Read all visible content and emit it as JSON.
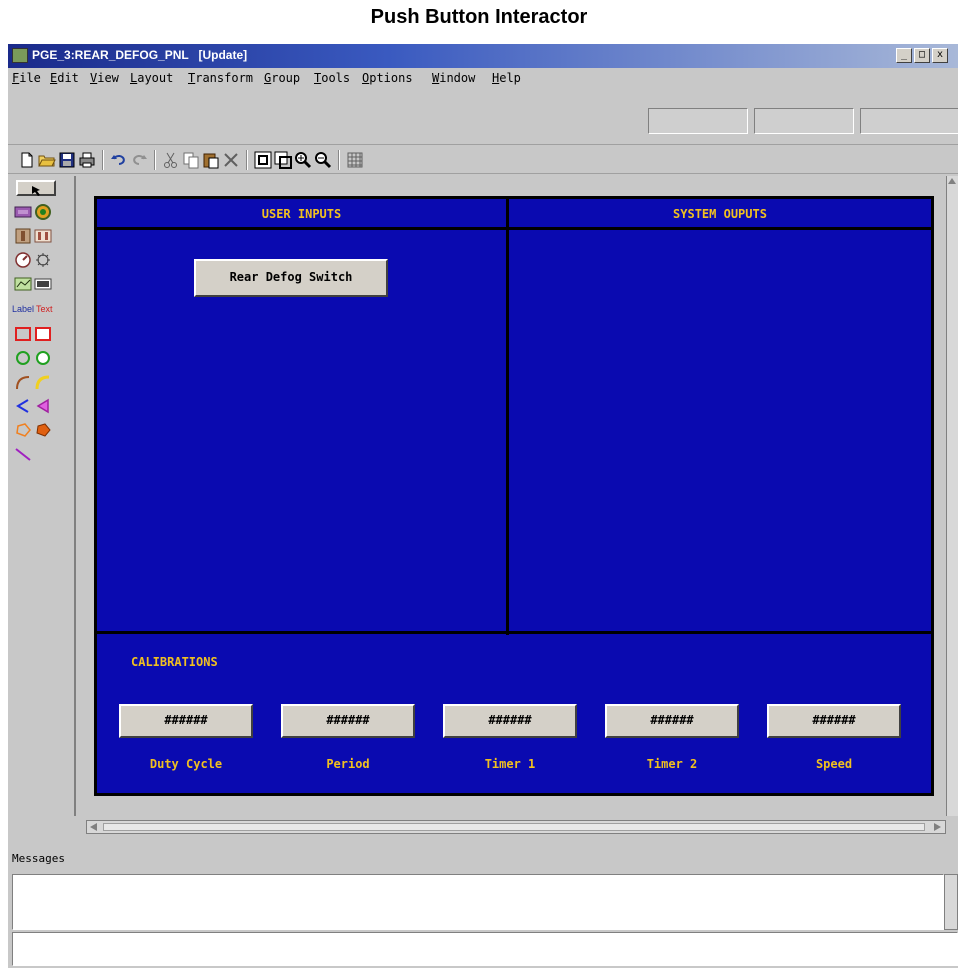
{
  "caption": "Push Button Interactor",
  "window": {
    "title": "PGE_3:REAR_DEFOG_PNL   [Update]",
    "controls": {
      "minimize": "_",
      "maximize": "□",
      "close": "x"
    }
  },
  "menu": [
    "File",
    "Edit",
    "View",
    "Layout",
    "Transform",
    "Group",
    "Tools",
    "Options",
    "Window",
    "Help"
  ],
  "toolbar_icons": [
    "new-icon",
    "open-icon",
    "save-icon",
    "print-icon",
    "undo-icon",
    "redo-icon",
    "cut-icon",
    "copy-icon",
    "paste-icon",
    "delete-icon",
    "zoom-fit-icon",
    "zoom-window-icon",
    "zoom-in-icon",
    "zoom-out-icon",
    "grid-icon"
  ],
  "palette": {
    "label_tool": "Label",
    "text_tool": "Text"
  },
  "panel": {
    "user_inputs_header": "USER INPUTS",
    "system_outputs_header": "SYSTEM OUPUTS",
    "rear_defog_button": "Rear Defog Switch",
    "calibrations_header": "CALIBRATIONS",
    "calibrations": [
      {
        "value": "######",
        "label": "Duty Cycle"
      },
      {
        "value": "######",
        "label": "Period"
      },
      {
        "value": "######",
        "label": "Timer 1"
      },
      {
        "value": "######",
        "label": "Timer 2"
      },
      {
        "value": "######",
        "label": "Speed"
      }
    ],
    "colors": {
      "background": "#0a0ab0",
      "label_text": "#f0c020"
    }
  },
  "messages": {
    "label": "Messages"
  }
}
